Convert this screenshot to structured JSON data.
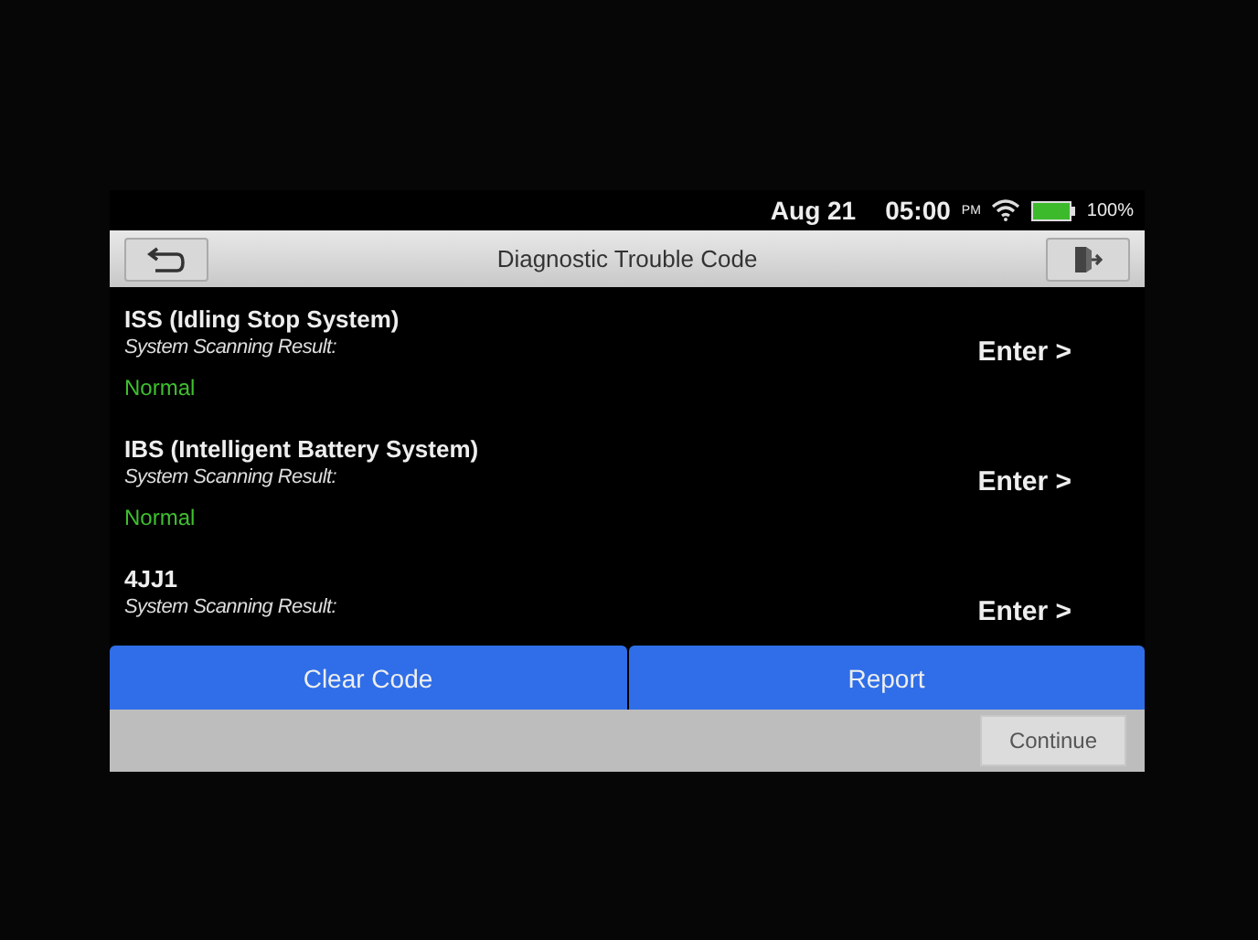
{
  "status_bar": {
    "date": "Aug 21",
    "time": "05:00",
    "ampm": "PM",
    "battery_text": "100%"
  },
  "title_bar": {
    "title": "Diagnostic Trouble Code"
  },
  "systems": [
    {
      "name": "ISS (Idling Stop System)",
      "label": "System Scanning Result:",
      "status": "Normal",
      "action": "Enter >"
    },
    {
      "name": "IBS (Intelligent Battery System)",
      "label": "System Scanning Result:",
      "status": "Normal",
      "action": "Enter >"
    },
    {
      "name": "4JJ1",
      "label": "System Scanning Result:",
      "action": "Enter >"
    }
  ],
  "action_buttons": [
    "Clear Code",
    "Report"
  ],
  "footer": {
    "button": "Continue"
  }
}
